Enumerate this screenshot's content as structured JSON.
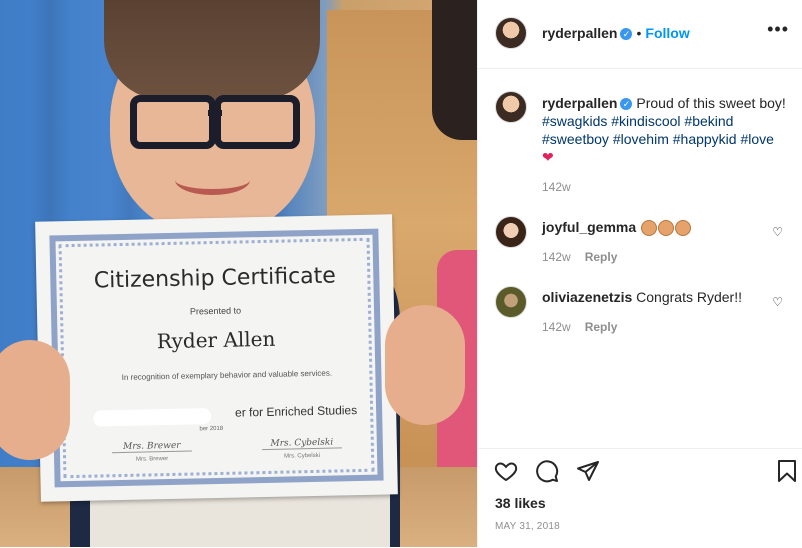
{
  "photo": {
    "certificate": {
      "title": "Citizenship Certificate",
      "presented_to": "Presented to",
      "recipient": "Ryder Allen",
      "description": "In recognition of exemplary behavior and valuable services.",
      "program": "er for Enriched Studies",
      "date": "ber 2018",
      "signature_left": "Mrs. Brewer",
      "signature_right": "Mrs. Cybelski",
      "signer_left": "Mrs. Brewer",
      "signer_right": "Mrs. Cybelski"
    }
  },
  "header": {
    "username": "ryderpallen",
    "separator": "•",
    "follow_label": "Follow",
    "more_icon": "more-horizontal-icon"
  },
  "caption": {
    "username": "ryderpallen",
    "text": "Proud of this sweet boy!",
    "hashtags": [
      "#swagkids",
      "#kindiscool",
      "#bekind",
      "#sweetboy",
      "#lovehim",
      "#happykid",
      "#love"
    ],
    "emoji": "❤",
    "time": "142w"
  },
  "comments": [
    {
      "username": "joyful_gemma",
      "text": "",
      "emoji": "clapping-hands x3",
      "time": "142w",
      "reply_label": "Reply"
    },
    {
      "username": "oliviazenetzis",
      "text": "Congrats Ryder!!",
      "time": "142w",
      "reply_label": "Reply"
    }
  ],
  "actions": {
    "likes": "38 likes",
    "date": "MAY 31, 2018",
    "icons": [
      "heart-icon",
      "comment-icon",
      "share-icon",
      "bookmark-icon"
    ]
  },
  "colors": {
    "link_blue": "#0095f6",
    "hashtag": "#00376b",
    "verified": "#3897f0",
    "muted": "#8e8e8e"
  }
}
